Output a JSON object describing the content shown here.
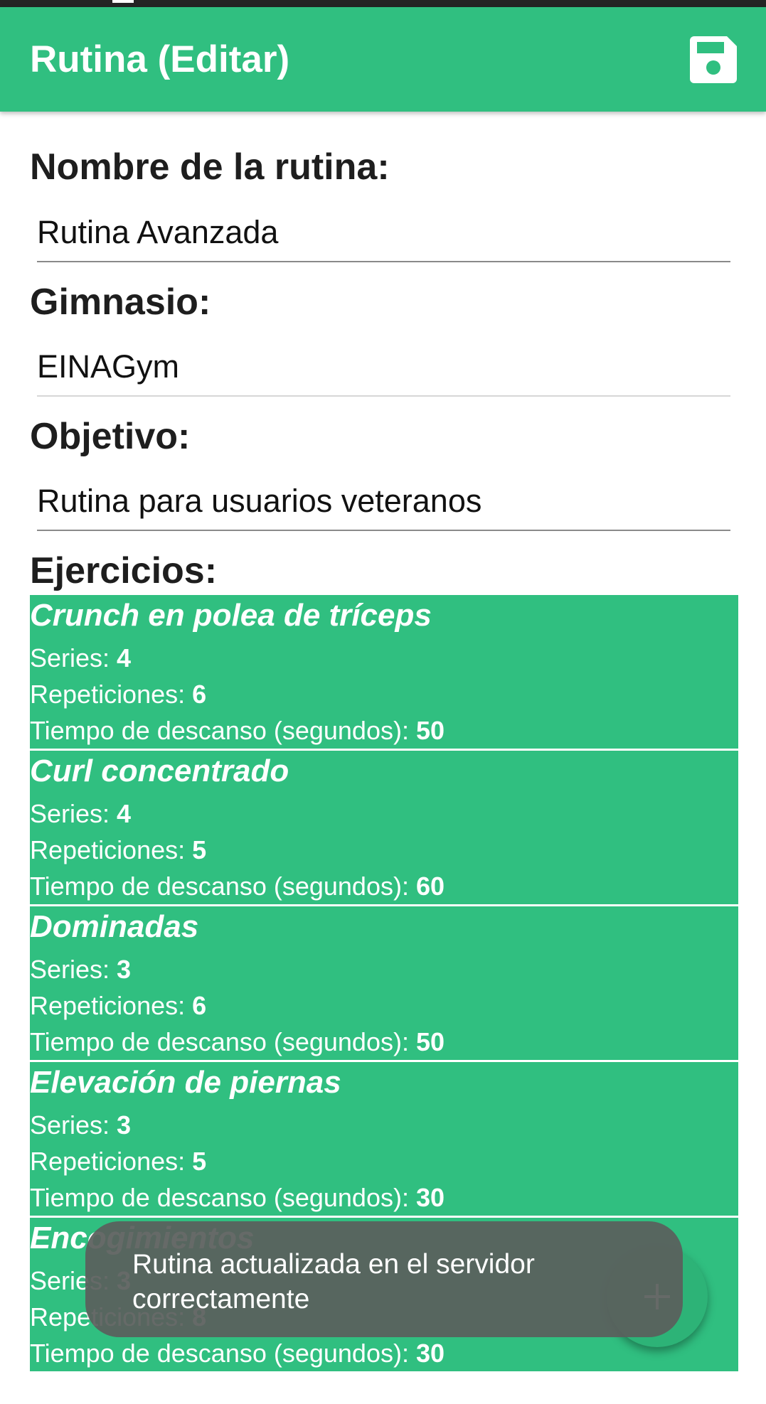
{
  "colors": {
    "accent": "#30bf80",
    "toast_bg": "#5a5f5c",
    "status_bar": "#242424"
  },
  "appbar": {
    "title": "Rutina (Editar)",
    "save_icon": "floppy-disk-icon"
  },
  "form": {
    "nombre_label": "Nombre de la rutina:",
    "nombre_value": "Rutina Avanzada",
    "gimnasio_label": "Gimnasio:",
    "gimnasio_value": "EINAGym",
    "objetivo_label": "Objetivo:",
    "objetivo_value": "Rutina para usuarios veteranos",
    "ejercicios_label": "Ejercicios:"
  },
  "labels": {
    "series": "Series: ",
    "repeticiones": "Repeticiones: ",
    "descanso": "Tiempo de descanso (segundos): "
  },
  "exercises": [
    {
      "name": "Crunch en polea de tríceps",
      "series": "4",
      "repeticiones": "6",
      "descanso": "50"
    },
    {
      "name": "Curl concentrado",
      "series": "4",
      "repeticiones": "5",
      "descanso": "60"
    },
    {
      "name": "Dominadas",
      "series": "3",
      "repeticiones": "6",
      "descanso": "50"
    },
    {
      "name": "Elevación de piernas",
      "series": "3",
      "repeticiones": "5",
      "descanso": "30"
    },
    {
      "name": "Encogimientos",
      "series": "3",
      "repeticiones": "8",
      "descanso": "30"
    }
  ],
  "toast": {
    "message": "Rutina actualizada en el servidor correctamente"
  },
  "fab": {
    "icon": "plus-icon"
  }
}
